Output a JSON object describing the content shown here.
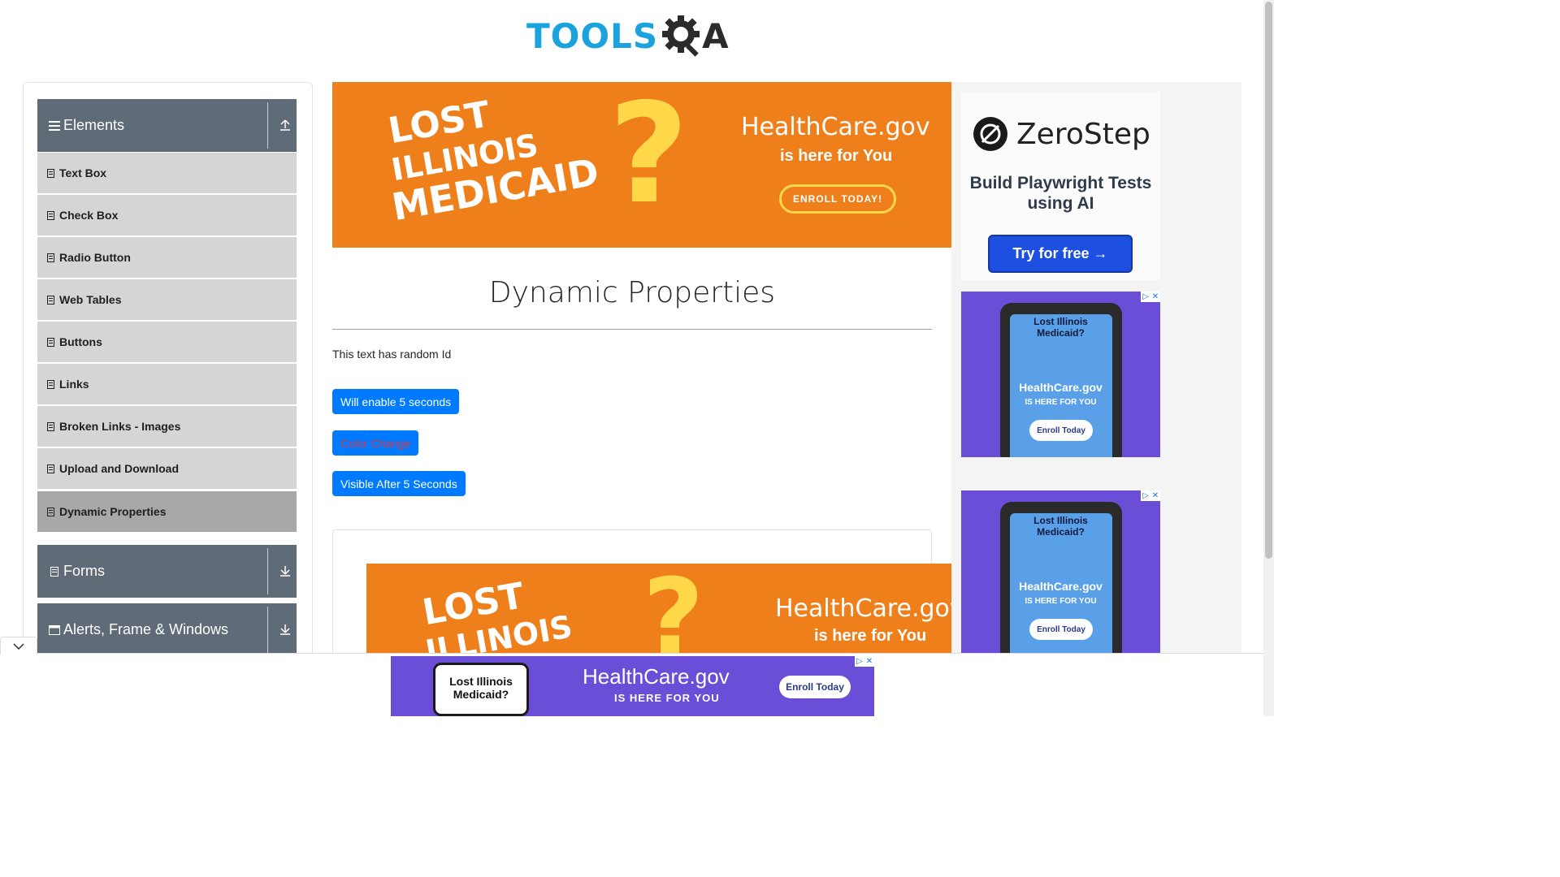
{
  "header": {
    "logo_tools": "TOOLS",
    "logo_a": "A"
  },
  "sidebar": {
    "groups": [
      {
        "title": "Elements"
      },
      {
        "title": "Forms"
      },
      {
        "title": "Alerts, Frame & Windows"
      }
    ],
    "items": [
      {
        "label": "Text Box"
      },
      {
        "label": "Check Box"
      },
      {
        "label": "Radio Button"
      },
      {
        "label": "Web Tables"
      },
      {
        "label": "Buttons"
      },
      {
        "label": "Links"
      },
      {
        "label": "Broken Links - Images"
      },
      {
        "label": "Upload and Download"
      },
      {
        "label": "Dynamic Properties"
      }
    ]
  },
  "main": {
    "title": "Dynamic Properties",
    "random_text": "This text has random Id",
    "buttons": {
      "enable": "Will enable 5 seconds",
      "color_change": "Color Change",
      "visible": "Visible After 5 Seconds"
    }
  },
  "ads": {
    "orange": {
      "line1": "LOST",
      "line2": "ILLINOIS",
      "line3": "MEDICAID",
      "brand": "HealthCare.gov",
      "tagline_a": "is here for",
      "tagline_b": "You",
      "cta": "ENROLL TODAY!"
    },
    "zerostep": {
      "name": "ZeroStep",
      "tagline": "Build Playwright Tests using AI",
      "cta": "Try for free →"
    },
    "purple": {
      "title": "Lost Illinois Medicaid?",
      "brand": "HealthCare.gov",
      "tagline": "IS HERE FOR YOU",
      "cta": "Enroll Today"
    },
    "bottom": {
      "card": "Lost Illinois Medicaid?",
      "brand": "HealthCare.gov",
      "tagline": "IS HERE FOR YOU",
      "cta": "Enroll Today"
    }
  },
  "colors": {
    "primary": "#007bff",
    "sidebar_header": "#5f6b76",
    "menu_item": "#d5d5d5",
    "menu_active": "#a8a8a8",
    "danger_text": "#dc3545"
  }
}
